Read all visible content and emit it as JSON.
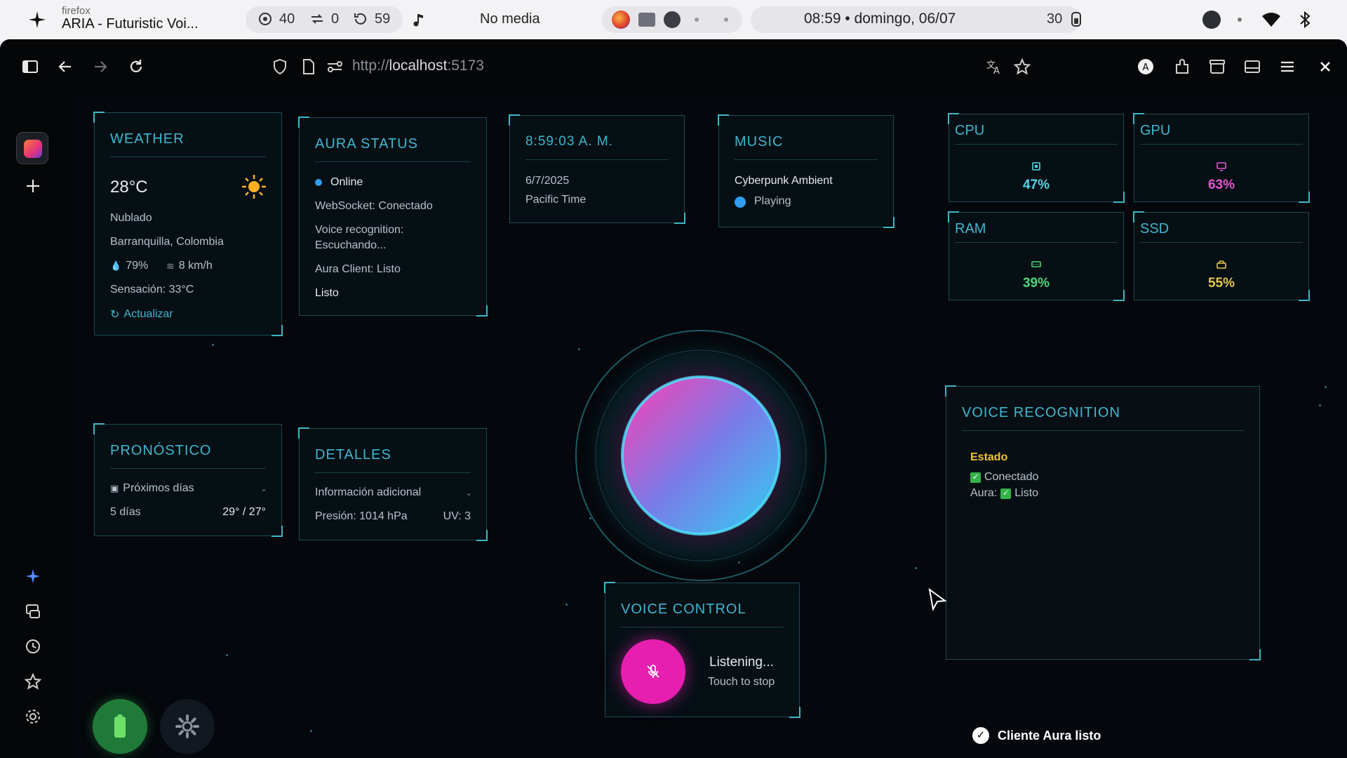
{
  "system_bar": {
    "app_sub": "firefox",
    "app_title": "ARIA - Futuristic Voi...",
    "stats": [
      "40",
      "0",
      "59"
    ],
    "media": "No media",
    "clock": "08:59 • domingo, 06/07",
    "battery": "30"
  },
  "browser": {
    "url_prefix": "http://",
    "url_host": "localhost",
    "url_port": ":5173"
  },
  "weather": {
    "title": "WEATHER",
    "temp": "28°C",
    "condition": "Nublado",
    "location": "Barranquilla, Colombia",
    "humidity": "79%",
    "wind": "8 km/h",
    "feels": "Sensación: 33°C",
    "refresh": "Actualizar"
  },
  "aura_status": {
    "title": "AURA STATUS",
    "online": "Online",
    "websocket": "WebSocket: Conectado",
    "voice_line1": "Voice recognition:",
    "voice_line2": "Escuchando...",
    "client": "Aura Client: Listo",
    "ready": "Listo"
  },
  "clock_panel": {
    "time": "8:59:03 A. M.",
    "date": "6/7/2025",
    "tz": "Pacific Time"
  },
  "music": {
    "title": "MUSIC",
    "track": "Cyberpunk Ambient",
    "state": "Playing"
  },
  "hardware": [
    {
      "label": "CPU",
      "value": "47%",
      "color": "#4fd6e6"
    },
    {
      "label": "GPU",
      "value": "63%",
      "color": "#e455d0"
    },
    {
      "label": "RAM",
      "value": "39%",
      "color": "#4fd67a"
    },
    {
      "label": "SSD",
      "value": "55%",
      "color": "#e6c84f"
    }
  ],
  "forecast": {
    "title": "PRONÓSTICO",
    "dropdown": "Próximos días",
    "days": "5 días",
    "range": "29° / 27°"
  },
  "details": {
    "title": "DETALLES",
    "dropdown": "Información adicional",
    "pressure": "Presión: 1014 hPa",
    "uv": "UV: 3"
  },
  "voice_recognition": {
    "title": "VOICE RECOGNITION",
    "state_label": "Estado",
    "connected": "Conectado",
    "aura_prefix": "Aura:",
    "aura_ready": "Listo"
  },
  "voice_control": {
    "title": "VOICE CONTROL",
    "status": "Listening...",
    "hint": "Touch to stop"
  },
  "toast": "Cliente Aura listo",
  "colors": {
    "accent_cyan": "#3fb7cf",
    "mic_pink": "#e61fb0",
    "battery_green": "#1f7a3a"
  }
}
